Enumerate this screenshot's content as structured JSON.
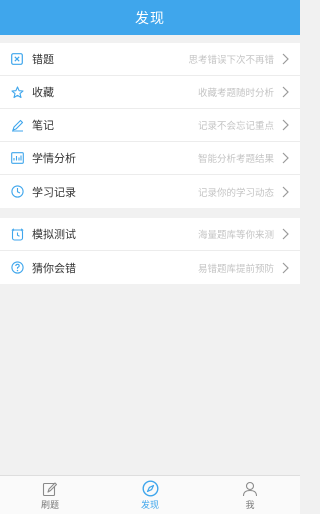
{
  "header": {
    "title": "发现"
  },
  "groups": [
    {
      "items": [
        {
          "icon": "error-box-icon",
          "label": "错题",
          "hint": "思考错误下次不再错"
        },
        {
          "icon": "star-icon",
          "label": "收藏",
          "hint": "收藏考题随时分析"
        },
        {
          "icon": "pen-icon",
          "label": "笔记",
          "hint": "记录不会忘记重点"
        },
        {
          "icon": "analysis-icon",
          "label": "学情分析",
          "hint": "智能分析考题结果"
        },
        {
          "icon": "clock-icon",
          "label": "学习记录",
          "hint": "记录你的学习动态"
        }
      ]
    },
    {
      "items": [
        {
          "icon": "alarm-clock-icon",
          "label": "模拟测试",
          "hint": "海量题库等你来测"
        },
        {
          "icon": "question-icon",
          "label": "猜你会错",
          "hint": "易错题库提前预防"
        }
      ]
    }
  ],
  "tabbar": {
    "tabs": [
      {
        "label": "刷题",
        "icon": "edit-icon",
        "active": false
      },
      {
        "label": "发现",
        "icon": "compass-icon",
        "active": true
      },
      {
        "label": "我",
        "icon": "person-icon",
        "active": false
      }
    ]
  },
  "colors": {
    "accent": "#3fa6ec",
    "background": "#f1f1f1"
  }
}
